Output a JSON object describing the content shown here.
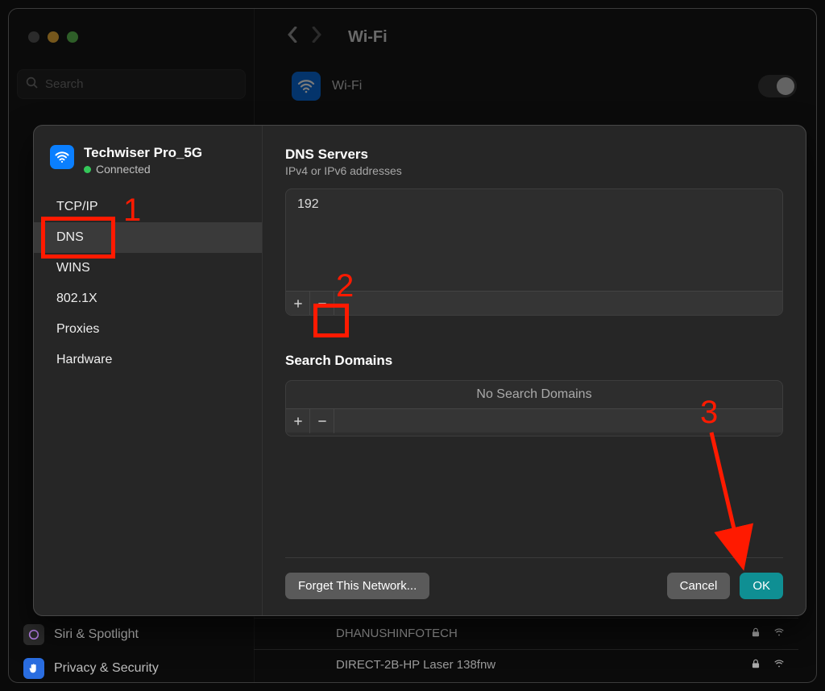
{
  "window": {
    "search_placeholder": "Search",
    "header_title": "Wi-Fi"
  },
  "wifi_section": {
    "label": "Wi-Fi"
  },
  "background": {
    "sidebar": [
      {
        "label": "Siri & Spotlight"
      },
      {
        "label": "Privacy & Security"
      }
    ],
    "networks": [
      {
        "name": "DHANUSHINFOTECH"
      },
      {
        "name": "DIRECT-2B-HP Laser 138fnw"
      }
    ]
  },
  "sheet": {
    "network": {
      "name": "Techwiser Pro_5G",
      "status": "Connected"
    },
    "tabs": [
      "TCP/IP",
      "DNS",
      "WINS",
      "802.1X",
      "Proxies",
      "Hardware"
    ],
    "active_tab": "DNS",
    "dns": {
      "section_title": "DNS Servers",
      "section_sub": "IPv4 or IPv6 addresses",
      "entries": [
        "192"
      ],
      "search_title": "Search Domains",
      "search_empty": "No Search Domains"
    },
    "buttons": {
      "forget": "Forget This Network...",
      "cancel": "Cancel",
      "ok": "OK"
    }
  },
  "annotations": {
    "n1": "1",
    "n2": "2",
    "n3": "3"
  }
}
